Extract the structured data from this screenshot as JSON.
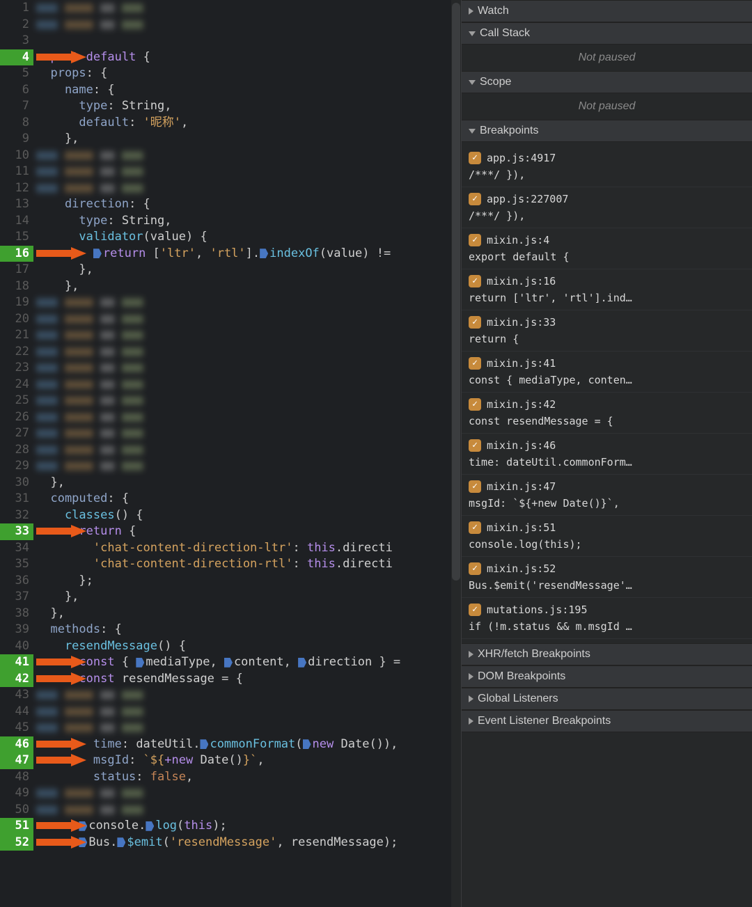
{
  "editor": {
    "filename": "mixin.js",
    "gutter_start": 3,
    "gutter_end": 52,
    "breakpoint_lines": [
      4,
      16,
      33,
      41,
      42,
      46,
      47,
      51,
      52
    ],
    "lines": {
      "l4": {
        "pre": "export default {",
        "tokens": [
          [
            "kw",
            "export"
          ],
          [
            "ident",
            " "
          ],
          [
            "kw",
            "default"
          ],
          [
            "punct",
            " {"
          ]
        ]
      },
      "l5": {
        "pre": "  props: {",
        "tokens": [
          [
            "prop",
            "  props"
          ],
          [
            "punct",
            ": {"
          ]
        ]
      },
      "l6": {
        "pre": "    name: {",
        "tokens": [
          [
            "prop",
            "    name"
          ],
          [
            "punct",
            ": {"
          ]
        ]
      },
      "l7": {
        "pre": "      type: String,",
        "tokens": [
          [
            "prop",
            "      type"
          ],
          [
            "punct",
            ": "
          ],
          [
            "ident",
            "String"
          ],
          [
            "punct",
            ","
          ]
        ]
      },
      "l8": {
        "pre": "      default: '昵称',",
        "tokens": [
          [
            "prop",
            "      default"
          ],
          [
            "punct",
            ": "
          ],
          [
            "str",
            "'昵称'"
          ],
          [
            "punct",
            ","
          ]
        ]
      },
      "l9": {
        "pre": "    },",
        "tokens": [
          [
            "punct",
            "    },"
          ]
        ]
      },
      "l13": {
        "pre": "    direction: {",
        "tokens": [
          [
            "prop",
            "    direction"
          ],
          [
            "punct",
            ": {"
          ]
        ]
      },
      "l14": {
        "pre": "      type: String,",
        "tokens": [
          [
            "prop",
            "      type"
          ],
          [
            "punct",
            ": "
          ],
          [
            "ident",
            "String"
          ],
          [
            "punct",
            ","
          ]
        ]
      },
      "l15": {
        "pre": "      validator(value) {",
        "tokens": [
          [
            "fn",
            "      validator"
          ],
          [
            "punct",
            "("
          ],
          [
            "ident",
            "value"
          ],
          [
            "punct",
            ") {"
          ]
        ]
      },
      "l16": {
        "pre": "        return ['ltr', 'rtl'].indexOf(value) !=",
        "tokens": [
          [
            "punct",
            "        "
          ],
          [
            "marker",
            ""
          ],
          [
            "kw",
            "return"
          ],
          [
            "punct",
            " ["
          ],
          [
            "str",
            "'ltr'"
          ],
          [
            "punct",
            ", "
          ],
          [
            "str",
            "'rtl'"
          ],
          [
            "punct",
            "]."
          ],
          [
            "marker",
            ""
          ],
          [
            "fn",
            "indexOf"
          ],
          [
            "punct",
            "("
          ],
          [
            "ident",
            "value"
          ],
          [
            "punct",
            ") !="
          ]
        ]
      },
      "l17": {
        "pre": "      },",
        "tokens": [
          [
            "punct",
            "      },"
          ]
        ]
      },
      "l18": {
        "pre": "    },",
        "tokens": [
          [
            "punct",
            "    },"
          ]
        ]
      },
      "l30": {
        "pre": "  },",
        "tokens": [
          [
            "punct",
            "  },"
          ]
        ]
      },
      "l31": {
        "pre": "  computed: {",
        "tokens": [
          [
            "prop",
            "  computed"
          ],
          [
            "punct",
            ": {"
          ]
        ]
      },
      "l32": {
        "pre": "    classes() {",
        "tokens": [
          [
            "fn",
            "    classes"
          ],
          [
            "punct",
            "() {"
          ]
        ]
      },
      "l33": {
        "pre": "      return {",
        "tokens": [
          [
            "punct",
            "      "
          ],
          [
            "kw",
            "return"
          ],
          [
            "punct",
            " {"
          ]
        ]
      },
      "l34": {
        "pre": "        'chat-content-direction-ltr': this.directi",
        "tokens": [
          [
            "punct",
            "        "
          ],
          [
            "str",
            "'chat-content-direction-ltr'"
          ],
          [
            "punct",
            ": "
          ],
          [
            "this",
            "this"
          ],
          [
            "punct",
            "."
          ],
          [
            "ident",
            "directi"
          ]
        ]
      },
      "l35": {
        "pre": "        'chat-content-direction-rtl': this.directi",
        "tokens": [
          [
            "punct",
            "        "
          ],
          [
            "str",
            "'chat-content-direction-rtl'"
          ],
          [
            "punct",
            ": "
          ],
          [
            "this",
            "this"
          ],
          [
            "punct",
            "."
          ],
          [
            "ident",
            "directi"
          ]
        ]
      },
      "l36": {
        "pre": "      };",
        "tokens": [
          [
            "punct",
            "      };"
          ]
        ]
      },
      "l37": {
        "pre": "    },",
        "tokens": [
          [
            "punct",
            "    },"
          ]
        ]
      },
      "l38": {
        "pre": "  },",
        "tokens": [
          [
            "punct",
            "  },"
          ]
        ]
      },
      "l39": {
        "pre": "  methods: {",
        "tokens": [
          [
            "prop",
            "  methods"
          ],
          [
            "punct",
            ": {"
          ]
        ]
      },
      "l40": {
        "pre": "    resendMessage() {",
        "tokens": [
          [
            "fn",
            "    resendMessage"
          ],
          [
            "punct",
            "() {"
          ]
        ]
      },
      "l41": {
        "pre": "      const { mediaType, content, direction } =",
        "tokens": [
          [
            "punct",
            "      "
          ],
          [
            "kw",
            "const"
          ],
          [
            "punct",
            " { "
          ],
          [
            "marker",
            ""
          ],
          [
            "ident",
            "mediaType"
          ],
          [
            "punct",
            ", "
          ],
          [
            "marker",
            ""
          ],
          [
            "ident",
            "content"
          ],
          [
            "punct",
            ", "
          ],
          [
            "marker",
            ""
          ],
          [
            "ident",
            "direction"
          ],
          [
            "punct",
            " } ="
          ]
        ]
      },
      "l42": {
        "pre": "      const resendMessage = {",
        "tokens": [
          [
            "punct",
            "      "
          ],
          [
            "kw",
            "const"
          ],
          [
            "punct",
            " "
          ],
          [
            "ident",
            "resendMessage"
          ],
          [
            "punct",
            " = {"
          ]
        ]
      },
      "l46": {
        "pre": "        time: dateUtil.commonFormat(new Date()),",
        "tokens": [
          [
            "prop",
            "        time"
          ],
          [
            "punct",
            ": "
          ],
          [
            "ident",
            "dateUtil"
          ],
          [
            "punct",
            "."
          ],
          [
            "marker",
            ""
          ],
          [
            "fn",
            "commonFormat"
          ],
          [
            "punct",
            "("
          ],
          [
            "marker",
            ""
          ],
          [
            "kw",
            "new"
          ],
          [
            "punct",
            " "
          ],
          [
            "ident",
            "Date"
          ],
          [
            "punct",
            "()),"
          ]
        ]
      },
      "l47": {
        "pre": "        msgId: `${+new Date()}`,",
        "tokens": [
          [
            "prop",
            "        msgId"
          ],
          [
            "punct",
            ": "
          ],
          [
            "str",
            "`${"
          ],
          [
            "kw",
            "+new"
          ],
          [
            "punct",
            " "
          ],
          [
            "ident",
            "Date"
          ],
          [
            "punct",
            "()"
          ],
          [
            "str",
            "}`"
          ],
          [
            "punct",
            ","
          ]
        ]
      },
      "l48": {
        "pre": "        status: false,",
        "tokens": [
          [
            "prop",
            "        status"
          ],
          [
            "punct",
            ": "
          ],
          [
            "bool",
            "false"
          ],
          [
            "punct",
            ","
          ]
        ]
      },
      "l51": {
        "pre": "      console.log(this);",
        "tokens": [
          [
            "punct",
            "      "
          ],
          [
            "marker",
            ""
          ],
          [
            "ident",
            "console"
          ],
          [
            "punct",
            "."
          ],
          [
            "marker",
            ""
          ],
          [
            "fn",
            "log"
          ],
          [
            "punct",
            "("
          ],
          [
            "this",
            "this"
          ],
          [
            "punct",
            ");"
          ]
        ]
      },
      "l52": {
        "pre": "      Bus.$emit('resendMessage', resendMessage);",
        "tokens": [
          [
            "punct",
            "      "
          ],
          [
            "marker",
            ""
          ],
          [
            "ident",
            "Bus"
          ],
          [
            "punct",
            "."
          ],
          [
            "marker",
            ""
          ],
          [
            "fn",
            "$emit"
          ],
          [
            "punct",
            "("
          ],
          [
            "str",
            "'resendMessage'"
          ],
          [
            "punct",
            ", "
          ],
          [
            "ident",
            "resendMessage"
          ],
          [
            "punct",
            ");"
          ]
        ]
      }
    },
    "blurred_ranges": [
      [
        1,
        2
      ],
      [
        10,
        12
      ],
      [
        19,
        29
      ],
      [
        43,
        45
      ],
      [
        49,
        50
      ]
    ]
  },
  "sidebar": {
    "sections": {
      "watch": {
        "label": "Watch",
        "expanded": false
      },
      "callstack": {
        "label": "Call Stack",
        "expanded": true,
        "body": "Not paused"
      },
      "scope": {
        "label": "Scope",
        "expanded": true,
        "body": "Not paused"
      },
      "breakpoints": {
        "label": "Breakpoints",
        "expanded": true
      },
      "xhr": {
        "label": "XHR/fetch Breakpoints",
        "expanded": false
      },
      "dom": {
        "label": "DOM Breakpoints",
        "expanded": false
      },
      "global": {
        "label": "Global Listeners",
        "expanded": false
      },
      "event": {
        "label": "Event Listener Breakpoints",
        "expanded": false
      }
    },
    "breakpoints": [
      {
        "loc": "app.js:4917",
        "preview": "/***/ }),"
      },
      {
        "loc": "app.js:227007",
        "preview": "/***/ }),"
      },
      {
        "loc": "mixin.js:4",
        "preview": "export default {"
      },
      {
        "loc": "mixin.js:16",
        "preview": "return ['ltr', 'rtl'].ind…"
      },
      {
        "loc": "mixin.js:33",
        "preview": "return {"
      },
      {
        "loc": "mixin.js:41",
        "preview": "const { mediaType, conten…"
      },
      {
        "loc": "mixin.js:42",
        "preview": "const resendMessage = {"
      },
      {
        "loc": "mixin.js:46",
        "preview": "time: dateUtil.commonForm…"
      },
      {
        "loc": "mixin.js:47",
        "preview": "msgId: `${+new Date()}`,"
      },
      {
        "loc": "mixin.js:51",
        "preview": "console.log(this);"
      },
      {
        "loc": "mixin.js:52",
        "preview": "Bus.$emit('resendMessage'…"
      },
      {
        "loc": "mutations.js:195",
        "preview": "if (!m.status && m.msgId …"
      }
    ]
  }
}
